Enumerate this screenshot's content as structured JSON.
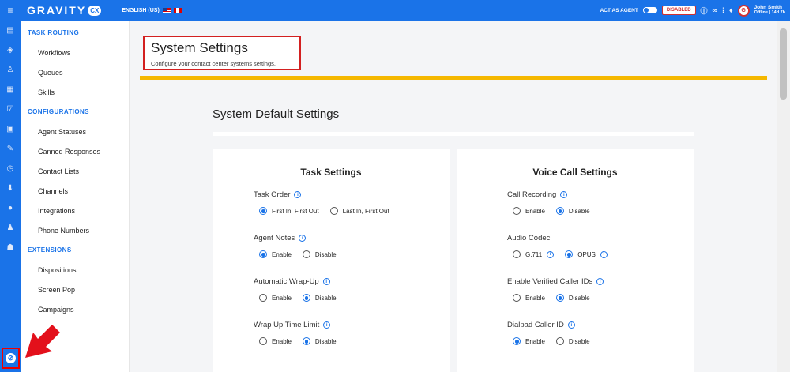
{
  "topbar": {
    "logo": "GRAVITY",
    "logo_badge": "CX",
    "language": "ENGLISH (US)",
    "act_as_agent": "ACT AS AGENT",
    "status_badge": "DISABLED",
    "user_name": "John Smith",
    "user_status": "Offline | 14d 7h",
    "avatar_initial": "G"
  },
  "sidebar": {
    "sections": [
      {
        "title": "TASK ROUTING",
        "items": [
          "Workflows",
          "Queues",
          "Skills"
        ]
      },
      {
        "title": "CONFIGURATIONS",
        "items": [
          "Agent Statuses",
          "Canned Responses",
          "Contact Lists",
          "Channels",
          "Integrations",
          "Phone Numbers"
        ]
      },
      {
        "title": "EXTENSIONS",
        "items": [
          "Dispositions",
          "Screen Pop",
          "Campaigns"
        ]
      }
    ]
  },
  "page": {
    "title": "System Settings",
    "subtitle": "Configure your contact center systems settings.",
    "section_title": "System Default Settings"
  },
  "task_settings": {
    "title": "Task Settings",
    "settings": [
      {
        "label": "Task Order",
        "options": [
          "First In, First Out",
          "Last In, First Out"
        ],
        "selected": 0
      },
      {
        "label": "Agent Notes",
        "options": [
          "Enable",
          "Disable"
        ],
        "selected": 0
      },
      {
        "label": "Automatic Wrap-Up",
        "options": [
          "Enable",
          "Disable"
        ],
        "selected": 1
      },
      {
        "label": "Wrap Up Time Limit",
        "options": [
          "Enable",
          "Disable"
        ],
        "selected": 1
      }
    ]
  },
  "voice_settings": {
    "title": "Voice Call Settings",
    "settings": [
      {
        "label": "Call Recording",
        "options": [
          "Enable",
          "Disable"
        ],
        "selected": 1
      },
      {
        "label": "Audio Codec",
        "options": [
          "G.711",
          "OPUS"
        ],
        "selected": 1
      },
      {
        "label": "Enable Verified Caller IDs",
        "options": [
          "Enable",
          "Disable"
        ],
        "selected": 1
      },
      {
        "label": "Dialpad Caller ID",
        "options": [
          "Enable",
          "Disable"
        ],
        "selected": 0
      }
    ]
  },
  "colors": {
    "primary": "#1a73e8",
    "accent_bar": "#f5b800",
    "highlight": "#d32020"
  }
}
